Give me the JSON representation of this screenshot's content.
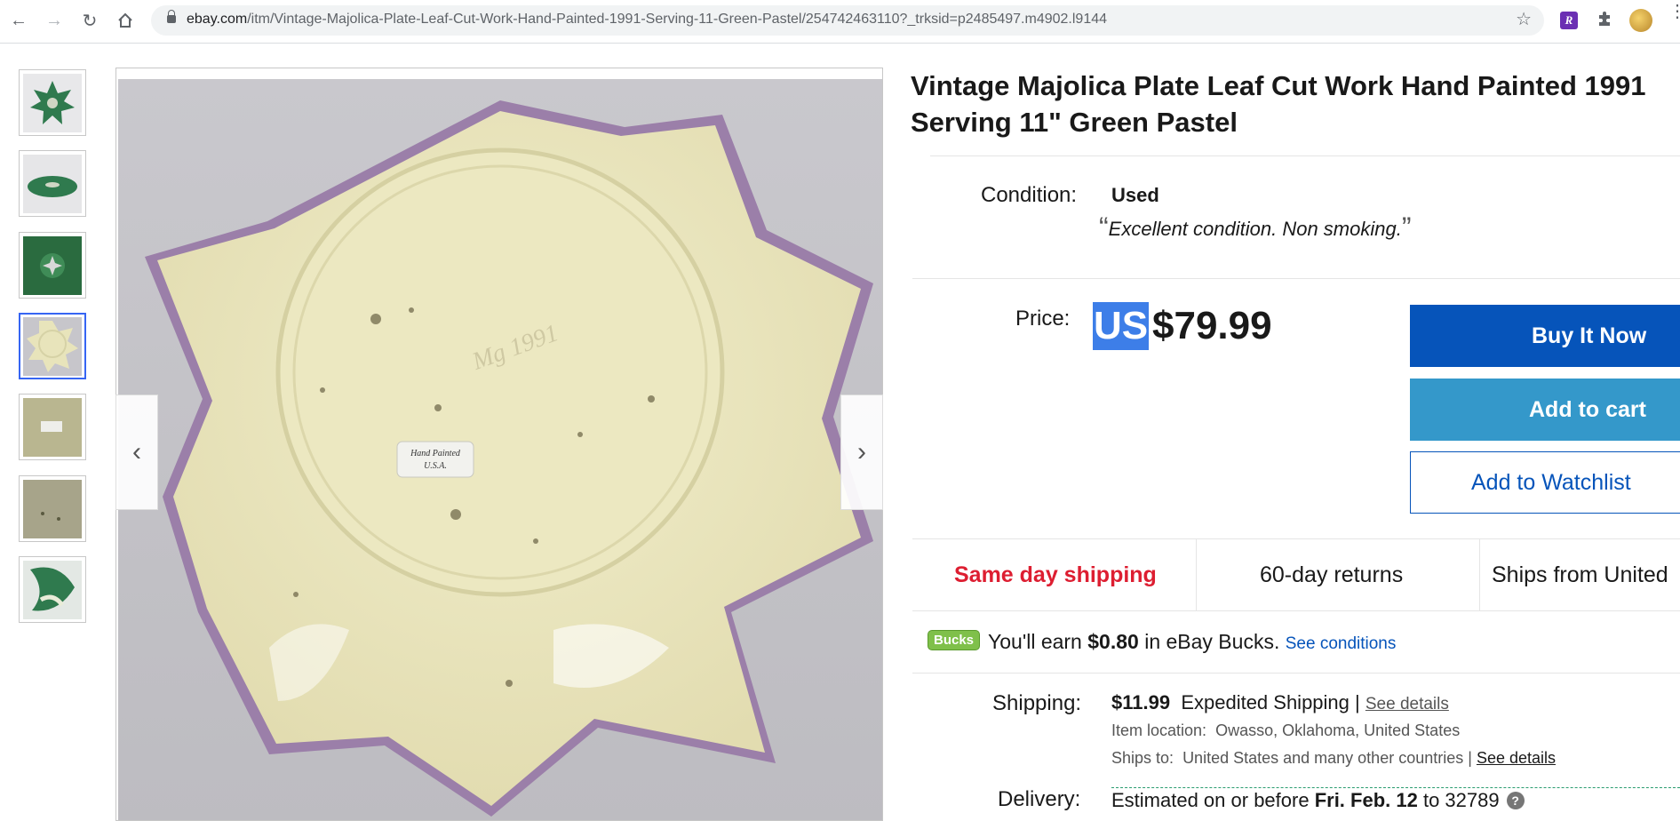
{
  "browser": {
    "url_host": "ebay.com",
    "url_path": "/itm/Vintage-Majolica-Plate-Leaf-Cut-Work-Hand-Painted-1991-Serving-11-Green-Pastel/254742463110?_trksid=p2485497.m4902.l9144",
    "ext1_letter": "R"
  },
  "gallery": {
    "thumb_count": 7,
    "active_index": 3,
    "prev_glyph": "‹",
    "next_glyph": "›"
  },
  "listing": {
    "title": "Vintage Majolica Plate Leaf Cut Work Hand Painted 1991 Serving 11\" Green Pastel",
    "condition_label": "Condition:",
    "condition_value": "Used",
    "condition_note": "Excellent condition. Non smoking.",
    "price_label": "Price:",
    "price_currency": "US",
    "price_amount": "$79.99"
  },
  "actions": {
    "buy_now": "Buy It Now",
    "add_to_cart": "Add to cart",
    "add_to_watchlist": "Add to Watchlist"
  },
  "features": {
    "same_day": "Same day shipping",
    "returns": "60-day returns",
    "ships_from": "Ships from United"
  },
  "bucks": {
    "badge": "Bucks",
    "text_pre": "You'll earn ",
    "amount": "$0.80",
    "text_post": " in eBay Bucks.",
    "link": "See conditions"
  },
  "shipping": {
    "label": "Shipping:",
    "amount": "$11.99",
    "method": "Expedited Shipping |",
    "details_link": "See details",
    "location_label": "Item location:",
    "location_value": "Owasso, Oklahoma, United States",
    "ships_to_label": "Ships to:",
    "ships_to_value": "United States and many other countries |",
    "ships_to_link": "See details"
  },
  "delivery": {
    "label": "Delivery:",
    "text_pre": "Estimated on or before ",
    "date": "Fri. Feb. 12",
    "text_post": " to 32789",
    "help": "?"
  },
  "colors": {
    "accent": "#0654ba",
    "cart": "#3498ca",
    "alert": "#dd1e31",
    "bucks": "#7fc04a"
  }
}
